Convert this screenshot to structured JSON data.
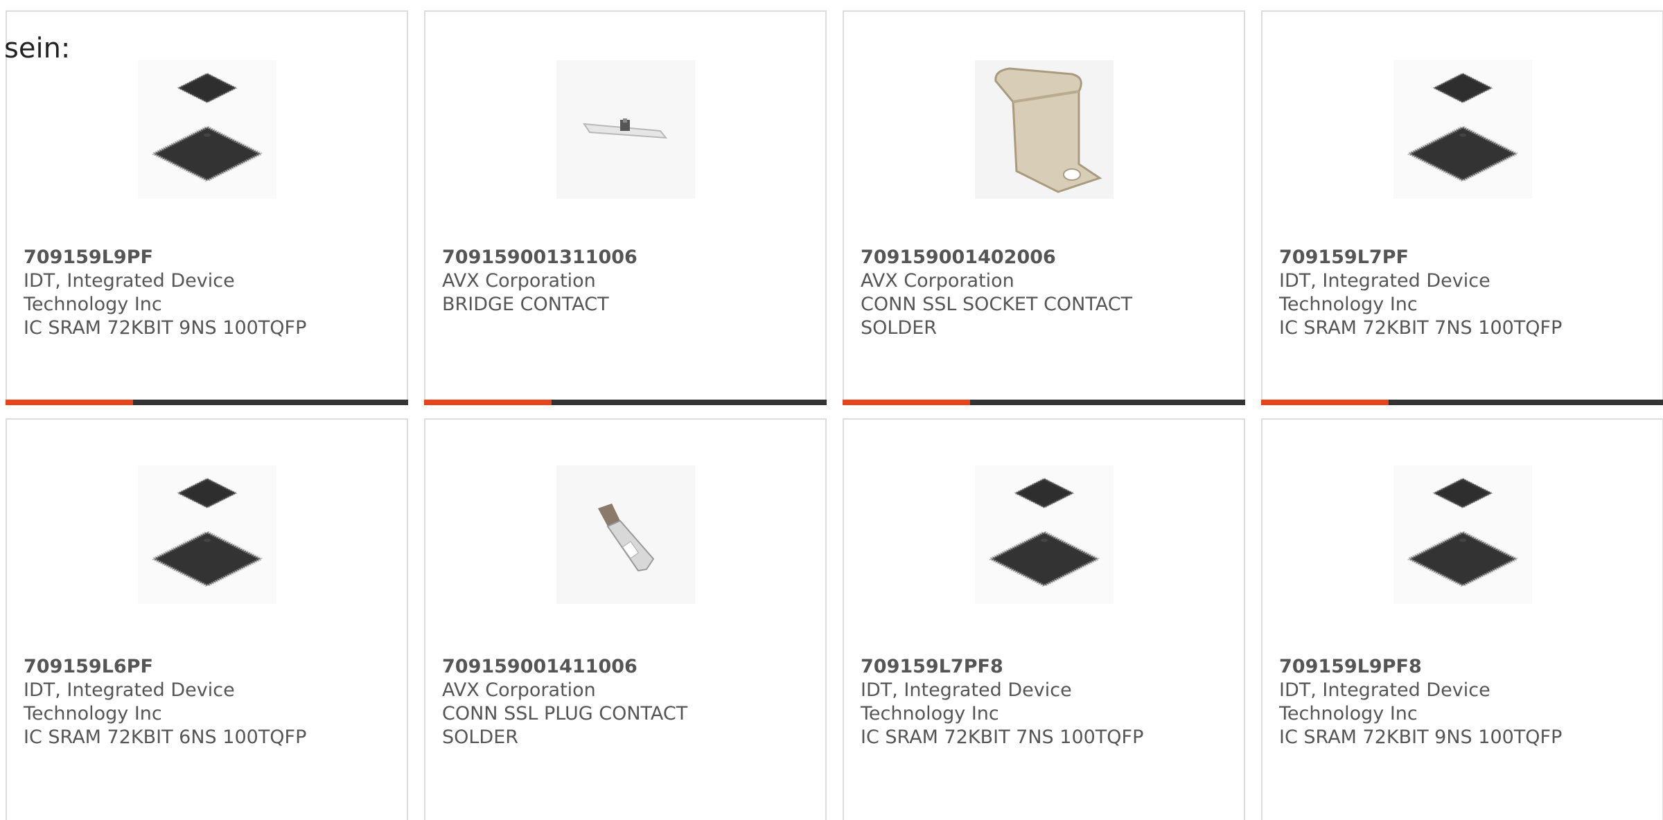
{
  "intro_text": "sein:",
  "colors": {
    "accent": "#e8431a",
    "bar": "#333333",
    "border": "#dcdcdc",
    "text": "#555555"
  },
  "products": [
    {
      "part": "709159L9PF",
      "maker_line1": "IDT, Integrated Device",
      "maker_line2": "Technology Inc",
      "desc_line1": "IC SRAM 72KBIT 9NS 100TQFP",
      "desc_line2": "",
      "image": "tqfp-chip-image"
    },
    {
      "part": "709159001311006",
      "maker_line1": "AVX Corporation",
      "maker_line2": "",
      "desc_line1": "BRIDGE CONTACT",
      "desc_line2": "",
      "image": "bridge-contact-image"
    },
    {
      "part": "709159001402006",
      "maker_line1": "AVX Corporation",
      "maker_line2": "",
      "desc_line1": "CONN SSL SOCKET CONTACT",
      "desc_line2": "SOLDER",
      "image": "socket-contact-image"
    },
    {
      "part": "709159L7PF",
      "maker_line1": "IDT, Integrated Device",
      "maker_line2": "Technology Inc",
      "desc_line1": "IC SRAM 72KBIT 7NS 100TQFP",
      "desc_line2": "",
      "image": "tqfp-chip-image"
    },
    {
      "part": "709159L6PF",
      "maker_line1": "IDT, Integrated Device",
      "maker_line2": "Technology Inc",
      "desc_line1": "IC SRAM 72KBIT 6NS 100TQFP",
      "desc_line2": "",
      "image": "tqfp-chip-image"
    },
    {
      "part": "709159001411006",
      "maker_line1": "AVX Corporation",
      "maker_line2": "",
      "desc_line1": "CONN SSL PLUG CONTACT",
      "desc_line2": "SOLDER",
      "image": "plug-contact-image"
    },
    {
      "part": "709159L7PF8",
      "maker_line1": "IDT, Integrated Device",
      "maker_line2": "Technology Inc",
      "desc_line1": "IC SRAM 72KBIT 7NS 100TQFP",
      "desc_line2": "",
      "image": "tqfp-chip-image"
    },
    {
      "part": "709159L9PF8",
      "maker_line1": "IDT, Integrated Device",
      "maker_line2": "Technology Inc",
      "desc_line1": "IC SRAM 72KBIT 9NS 100TQFP",
      "desc_line2": "",
      "image": "tqfp-chip-image"
    }
  ]
}
